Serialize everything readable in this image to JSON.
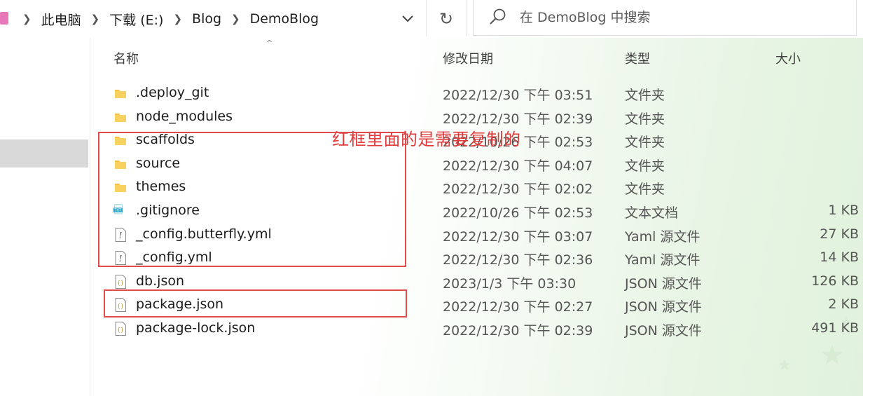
{
  "breadcrumb": [
    "此电脑",
    "下载 (E:)",
    "Blog",
    "DemoBlog"
  ],
  "search": {
    "placeholder": "在 DemoBlog 中搜索"
  },
  "columns": {
    "name": "名称",
    "date": "修改日期",
    "type": "类型",
    "size": "大小"
  },
  "annotation": "红框里面的是需要复制的",
  "files": [
    {
      "icon": "folder-icon",
      "name": ".deploy_git",
      "date": "2022/12/30 下午 03:51",
      "type": "文件夹",
      "size": ""
    },
    {
      "icon": "folder-icon",
      "name": "node_modules",
      "date": "2022/12/30 下午 02:39",
      "type": "文件夹",
      "size": ""
    },
    {
      "icon": "folder-icon",
      "name": "scaffolds",
      "date": "2022/10/26 下午 02:53",
      "type": "文件夹",
      "size": ""
    },
    {
      "icon": "folder-icon",
      "name": "source",
      "date": "2022/12/30 下午 04:07",
      "type": "文件夹",
      "size": ""
    },
    {
      "icon": "folder-icon",
      "name": "themes",
      "date": "2022/12/30 下午 02:02",
      "type": "文件夹",
      "size": ""
    },
    {
      "icon": "text-file-icon",
      "name": ".gitignore",
      "date": "2022/10/26 下午 02:53",
      "type": "文本文档",
      "size": "1 KB"
    },
    {
      "icon": "yaml-file-icon",
      "name": "_config.butterfly.yml",
      "date": "2022/12/30 下午 03:07",
      "type": "Yaml 源文件",
      "size": "27 KB"
    },
    {
      "icon": "yaml-file-icon",
      "name": "_config.yml",
      "date": "2022/12/30 下午 02:36",
      "type": "Yaml 源文件",
      "size": "14 KB"
    },
    {
      "icon": "json-file-icon",
      "name": "db.json",
      "date": "2023/1/3 下午 03:30",
      "type": "JSON 源文件",
      "size": "126 KB"
    },
    {
      "icon": "json-file-icon",
      "name": "package.json",
      "date": "2022/12/30 下午 02:27",
      "type": "JSON 源文件",
      "size": "2 KB"
    },
    {
      "icon": "json-file-icon",
      "name": "package-lock.json",
      "date": "2022/12/30 下午 02:39",
      "type": "JSON 源文件",
      "size": "491 KB"
    }
  ],
  "colors": {
    "annotation": "#e03a3a",
    "folder": "#f6c143",
    "selection": "#d9d9d9"
  }
}
